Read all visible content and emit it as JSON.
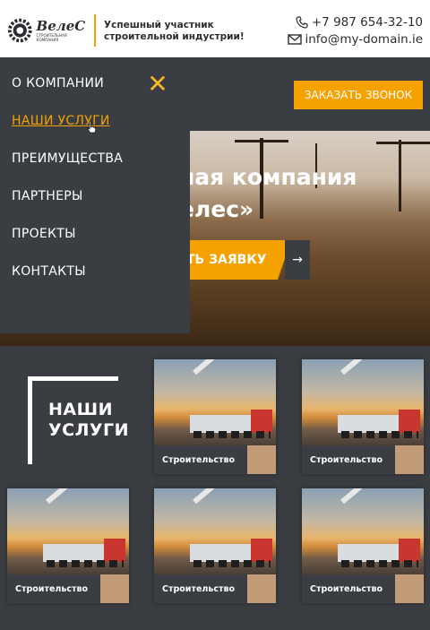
{
  "header": {
    "logo_name": "ВелеС",
    "logo_sub": "СТРОИТЕЛЬНАЯ КОМПАНИЯ",
    "tagline_line1": "Успешный участник",
    "tagline_line2": "строительной индустрии!",
    "phone": "+7 987 654-32-10",
    "email": "info@my-domain.ie"
  },
  "order_button": "ЗАКАЗАТЬ ЗВОНОК",
  "hero": {
    "title_line1": "ная компания",
    "title_line2": "елес»",
    "cta": "ТЬ ЗАЯВКУ",
    "cta_arrow": "→"
  },
  "menu": {
    "close": "✕",
    "items": [
      {
        "label": "О КОМПАНИИ"
      },
      {
        "label": "НАШИ УСЛУГИ"
      },
      {
        "label": "ПРЕИМУЩЕСТВА"
      },
      {
        "label": "ПАРТНЕРЫ"
      },
      {
        "label": "ПРОЕКТЫ"
      },
      {
        "label": "КОНТАКТЫ"
      }
    ]
  },
  "services": {
    "title_line1": "НАШИ",
    "title_line2": "УСЛУГИ",
    "cards": [
      {
        "label": "Строительство"
      },
      {
        "label": "Строительство"
      },
      {
        "label": "Строительство"
      },
      {
        "label": "Строительство"
      },
      {
        "label": "Строительство"
      }
    ]
  },
  "colors": {
    "accent": "#f5a100",
    "dark": "#3a3d42",
    "white": "#ffffff"
  }
}
